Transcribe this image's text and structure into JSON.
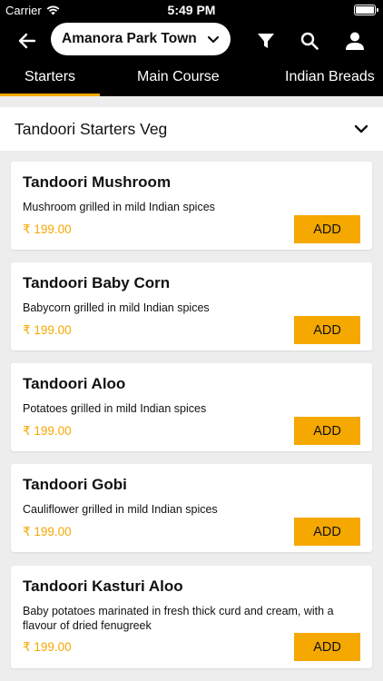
{
  "status": {
    "carrier": "Carrier",
    "time": "5:49 PM"
  },
  "appbar": {
    "location": "Amanora Park Town"
  },
  "tabs": [
    {
      "label": "Starters",
      "active": true
    },
    {
      "label": "Main Course",
      "active": false
    },
    {
      "label": "Indian Breads",
      "active": false
    }
  ],
  "section": {
    "title": "Tandoori Starters Veg"
  },
  "colors": {
    "accent": "#f5a800",
    "bar": "#000000",
    "background": "#ededed"
  },
  "items": [
    {
      "name": "Tandoori Mushroom",
      "description": "Mushroom grilled in mild Indian spices",
      "price": "₹ 199.00",
      "button": "ADD"
    },
    {
      "name": "Tandoori Baby Corn",
      "description": "Babycorn grilled in mild Indian spices",
      "price": "₹ 199.00",
      "button": "ADD"
    },
    {
      "name": "Tandoori Aloo",
      "description": "Potatoes grilled in mild Indian spices",
      "price": "₹ 199.00",
      "button": "ADD"
    },
    {
      "name": "Tandoori Gobi",
      "description": "Cauliflower grilled in mild Indian spices",
      "price": "₹ 199.00",
      "button": "ADD"
    },
    {
      "name": "Tandoori Kasturi Aloo",
      "description": "Baby potatoes marinated in fresh thick curd and cream, with a flavour of dried fenugreek",
      "price": "₹ 199.00",
      "button": "ADD"
    }
  ]
}
